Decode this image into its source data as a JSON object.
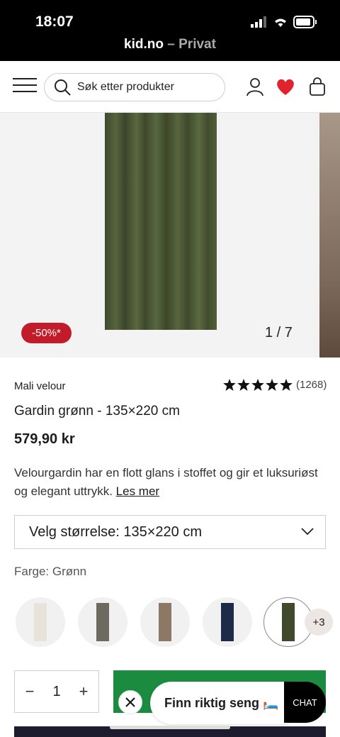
{
  "status": {
    "time": "18:07",
    "domain": "kid.no",
    "separator": " – ",
    "mode": "Privat"
  },
  "header": {
    "search_placeholder": "Søk etter produkter",
    "wishlist_color": "#e0232d"
  },
  "gallery": {
    "discount_badge": "-50%*",
    "counter": "1 / 7"
  },
  "product": {
    "brand": "Mali velour",
    "rating_count": "(1268)",
    "stars": 5,
    "title": "Gardin grønn - 135×220 cm",
    "price": "579,90 kr",
    "description": "Velourgardin har en flott glans i stoffet og gir et luksuriøst og elegant uttrykk.",
    "read_more": "Les mer"
  },
  "size": {
    "selected": "Velg størrelse: 135×220 cm"
  },
  "color": {
    "label": "Farge:",
    "value": "Grønn",
    "swatches": [
      {
        "name": "white",
        "color": "#e8e3da"
      },
      {
        "name": "grey",
        "color": "#6d6a60"
      },
      {
        "name": "beige",
        "color": "#8c7864"
      },
      {
        "name": "navy",
        "color": "#1d2a48"
      },
      {
        "name": "green",
        "color": "#3f4a2d",
        "selected": true
      }
    ],
    "more": "+3"
  },
  "purchase": {
    "quantity": "1",
    "minus": "−",
    "plus": "+"
  },
  "floating": {
    "finder_label": "Finn riktig seng 🛏️",
    "chat_label": "CHAT"
  }
}
